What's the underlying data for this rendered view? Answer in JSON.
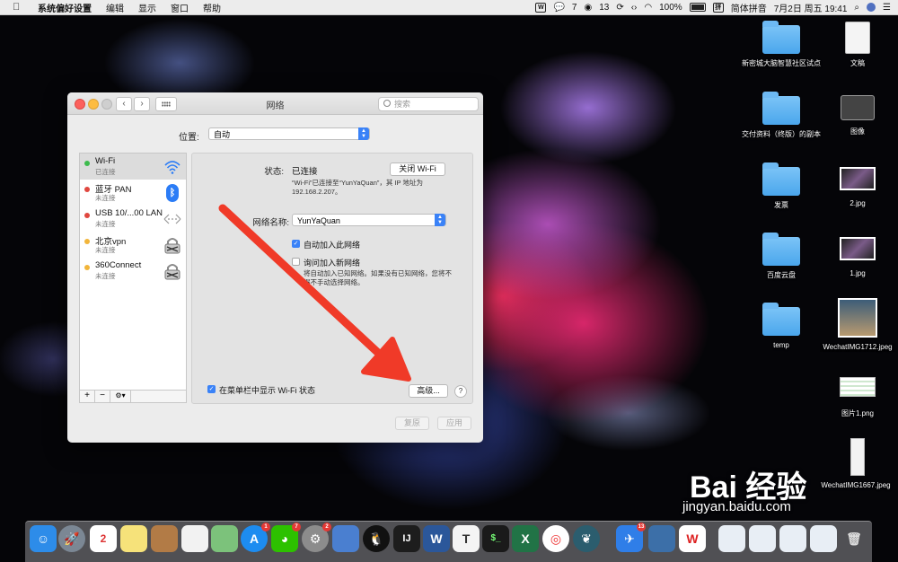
{
  "menubar": {
    "apple": "",
    "app_name": "系统偏好设置",
    "menus": [
      "编辑",
      "显示",
      "窗口",
      "帮助"
    ],
    "status": {
      "wechat_count": "7",
      "qq_count": "13",
      "battery": "100%",
      "input_method": "简体拼音",
      "datetime": "7月2日 周五  19:41"
    }
  },
  "window": {
    "title": "网络",
    "search_placeholder": "搜索",
    "location_label": "位置:",
    "location_value": "自动",
    "services": [
      {
        "name": "Wi-Fi",
        "status": "已连接",
        "color": "#3dbb4d",
        "icon": "wifi-icon"
      },
      {
        "name": "蓝牙 PAN",
        "status": "未连接",
        "color": "#e0473f",
        "icon": "bluetooth-icon"
      },
      {
        "name": "USB 10/...00 LAN",
        "status": "未连接",
        "color": "#e0473f",
        "icon": "ethernet-icon"
      },
      {
        "name": "北京vpn",
        "status": "未连接",
        "color": "#f2b53a",
        "icon": "lock-icon"
      },
      {
        "name": "360Connect",
        "status": "未连接",
        "color": "#f2b53a",
        "icon": "lock-icon"
      }
    ],
    "tools": {
      "add": "+",
      "remove": "−",
      "gear": "⚙▾"
    },
    "detail": {
      "status_label": "状态:",
      "status_value": "已连接",
      "turn_off_button": "关闭 Wi-Fi",
      "status_desc_1": "“Wi-Fi”已连接至“YunYaQuan”，其 IP 地址为",
      "status_desc_2": "192.168.2.207。",
      "network_name_label": "网络名称:",
      "network_name_value": "YunYaQuan",
      "auto_join_label": "自动加入此网络",
      "auto_join_checked": true,
      "ask_join_label": "询问加入新网络",
      "ask_join_checked": false,
      "ask_desc_1": "将自动加入已知网络。如果没有已知网络，您将不",
      "ask_desc_2": "得不手动选择网络。",
      "show_menubar_label": "在菜单栏中显示 Wi-Fi 状态",
      "show_menubar_checked": true,
      "advanced_button": "高级...",
      "help_button": "?"
    },
    "revert_button": "复原",
    "apply_button": "应用"
  },
  "desktop_icons": [
    {
      "label": "新密城大脑智慧社区试点",
      "type": "folder"
    },
    {
      "label": "文稿",
      "type": "document"
    },
    {
      "label": "交付资料（终版）的副本",
      "type": "folder"
    },
    {
      "label": "图像",
      "type": "drive"
    },
    {
      "label": "发票",
      "type": "folder"
    },
    {
      "label": "2.jpg",
      "type": "image"
    },
    {
      "label": "百度云盘",
      "type": "folder"
    },
    {
      "label": "1.jpg",
      "type": "image"
    },
    {
      "label": "temp",
      "type": "folder"
    },
    {
      "label": "WechatIMG1712.jpeg",
      "type": "image"
    },
    {
      "label": "图片1.png",
      "type": "image"
    },
    {
      "label": "WechatIMG1667.jpeg",
      "type": "image"
    }
  ],
  "watermark": {
    "text": "Bai 经验",
    "url_text": "jingyan.baidu.com"
  },
  "dock_badges": {
    "appstore": "1",
    "wechat": "7",
    "settings": "2",
    "qq_mail": "13"
  },
  "colors": {
    "accent": "#3a82f7",
    "arrow": "#f03a28"
  }
}
